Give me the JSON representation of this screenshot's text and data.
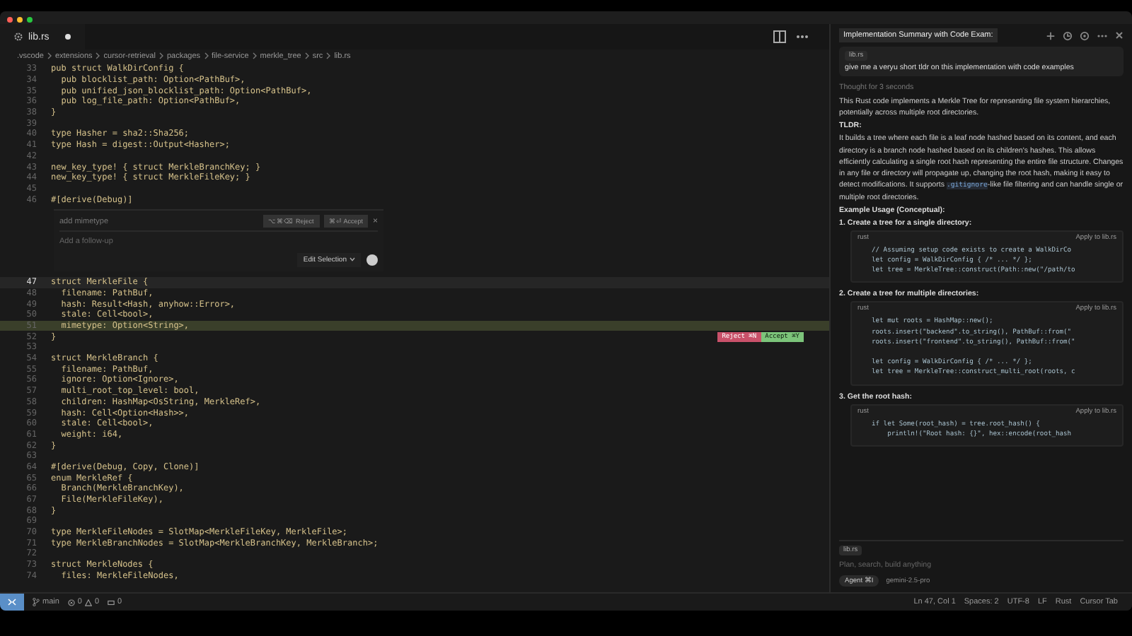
{
  "tab": {
    "label": "lib.rs",
    "modified": true
  },
  "breadcrumbs": [
    ".vscode",
    "extensions",
    "cursor-retrieval",
    "packages",
    "file-service",
    "merkle_tree",
    "src",
    "lib.rs"
  ],
  "code_before": [
    {
      "num": "33",
      "text": "pub struct WalkDirConfig {"
    },
    {
      "num": "34",
      "text": "  pub blocklist_path: Option<PathBuf>,"
    },
    {
      "num": "35",
      "text": "  pub unified_json_blocklist_path: Option<PathBuf>,"
    },
    {
      "num": "36",
      "text": "  pub log_file_path: Option<PathBuf>,"
    },
    {
      "num": "38",
      "text": "}"
    },
    {
      "num": "39"
    },
    {
      "num": "40",
      "text": "type Hasher = sha2::Sha256;"
    },
    {
      "num": "41",
      "text": "type Hash = digest::Output<Hasher>;"
    },
    {
      "num": "42"
    },
    {
      "num": "43",
      "text": "new_key_type! { struct MerkleBranchKey; }"
    },
    {
      "num": "44",
      "text": "new_key_type! { struct MerkleFileKey; }"
    },
    {
      "num": "45"
    },
    {
      "num": "46",
      "text": "#[derive(Debug)]"
    }
  ],
  "prompt": {
    "value": "add mimetype",
    "reject": "⌥⌘⌫ Reject",
    "accept": "⌘⏎ Accept",
    "close": "×",
    "followup_placeholder": "Add a follow-up",
    "mode": "Edit Selection"
  },
  "code_after": [
    {
      "num": "47",
      "text": "struct MerkleFile {",
      "current": true,
      "added": false
    },
    {
      "num": "48",
      "text": "  filename: PathBuf,",
      "current": false,
      "added": false
    },
    {
      "num": "49",
      "text": "  hash: Result<Hash, anyhow::Error>,",
      "current": false,
      "added": false
    },
    {
      "num": "50",
      "text": "  stale: Cell<bool>,",
      "current": false,
      "added": false
    },
    {
      "num": "51",
      "text": "  mimetype: Option<String>,",
      "current": false,
      "added": true
    },
    {
      "num": "52",
      "text": "}",
      "current": false,
      "added": false
    },
    {
      "num": "53",
      "current": false,
      "added": false
    },
    {
      "num": "54",
      "text": "struct MerkleBranch {",
      "current": false,
      "added": false
    },
    {
      "num": "55",
      "text": "  filename: PathBuf,",
      "current": false,
      "added": false
    },
    {
      "num": "56",
      "text": "  ignore: Option<Ignore>,",
      "current": false,
      "added": false
    },
    {
      "num": "57",
      "text": "  multi_root_top_level: bool,",
      "current": false,
      "added": false
    },
    {
      "num": "58",
      "text": "  children: HashMap<OsString, MerkleRef>,",
      "current": false,
      "added": false
    },
    {
      "num": "59",
      "text": "  hash: Cell<Option<Hash>>,",
      "current": false,
      "added": false
    },
    {
      "num": "60",
      "text": "  stale: Cell<bool>,",
      "current": false,
      "added": false
    },
    {
      "num": "61",
      "text": "  weight: i64,",
      "current": false,
      "added": false
    },
    {
      "num": "62",
      "text": "}",
      "current": false,
      "added": false
    },
    {
      "num": "63",
      "current": false,
      "added": false
    },
    {
      "num": "64",
      "text": "#[derive(Debug, Copy, Clone)]",
      "current": false,
      "added": false
    },
    {
      "num": "65",
      "text": "enum MerkleRef {",
      "current": false,
      "added": false
    },
    {
      "num": "66",
      "text": "  Branch(MerkleBranchKey),",
      "current": false,
      "added": false
    },
    {
      "num": "67",
      "text": "  File(MerkleFileKey),",
      "current": false,
      "added": false
    },
    {
      "num": "68",
      "text": "}",
      "current": false,
      "added": false
    },
    {
      "num": "69",
      "current": false,
      "added": false
    },
    {
      "num": "70",
      "text": "type MerkleFileNodes = SlotMap<MerkleFileKey, MerkleFile>;",
      "current": false,
      "added": false
    },
    {
      "num": "71",
      "text": "type MerkleBranchNodes = SlotMap<MerkleBranchKey, MerkleBranch>;",
      "current": false,
      "added": false
    },
    {
      "num": "72",
      "current": false,
      "added": false
    },
    {
      "num": "73",
      "text": "struct MerkleNodes {",
      "current": false,
      "added": false
    },
    {
      "num": "74",
      "text": "  files: MerkleFileNodes,",
      "current": false,
      "added": false
    }
  ],
  "diff_actions": {
    "reject": "Reject ⌘N",
    "accept": "Accept ⌘Y"
  },
  "chat": {
    "title": "Implementation Summary with Code Exam:",
    "context_chip": "lib.rs",
    "user_message": "give me a veryu short tldr on this implementation with code examples",
    "thought": "Thought for 3 seconds",
    "intro": "This Rust code implements a Merkle Tree for representing file system hierarchies, potentially across multiple root directories.",
    "tldr_heading": "TLDR:",
    "tldr_before": "It builds a tree where each file is a leaf node hashed based on its content, and each directory is a branch node hashed based on its children's hashes. This allows efficiently calculating a single root hash representing the entire file structure. Changes in any file or directory will propagate up, changing the root hash, making it easy to detect modifications. It supports",
    "tldr_code": ".gitignore",
    "tldr_after": "-like file filtering and can handle single or multiple root directories.",
    "example_heading": "Example Usage (Conceptual):",
    "steps": [
      {
        "title": "1. Create a tree for a single directory:",
        "lang": "rust",
        "apply": "Apply to lib.rs",
        "groups": [
          [
            "// Assuming setup code exists to create a WalkDirCo",
            "let config = WalkDirConfig { /* ... */ };",
            "let tree = MerkleTree::construct(Path::new(\"/path/to"
          ]
        ]
      },
      {
        "title": "2. Create a tree for multiple directories:",
        "lang": "rust",
        "apply": "Apply to lib.rs",
        "groups": [
          [
            "let mut roots = HashMap::new();",
            "roots.insert(\"backend\".to_string(), PathBuf::from(\"",
            "roots.insert(\"frontend\".to_string(), PathBuf::from(\""
          ],
          [
            "let config = WalkDirConfig { /* ... */ };",
            "let tree = MerkleTree::construct_multi_root(roots, c"
          ]
        ]
      },
      {
        "title": "3. Get the root hash:",
        "lang": "rust",
        "apply": "Apply to lib.rs",
        "groups": [
          [
            "if let Some(root_hash) = tree.root_hash() {",
            "    println!(\"Root hash: {}\", hex::encode(root_hash"
          ]
        ]
      }
    ],
    "input_chip": "lib.rs",
    "input_placeholder": "Plan, search, build anything",
    "agent": "Agent ⌘I",
    "model": "gemini-2.5-pro"
  },
  "status_left": {
    "branch": "main",
    "errors": "0",
    "warnings": "0",
    "ports": "0"
  },
  "status_right": [
    "Ln 47, Col 1",
    "Spaces: 2",
    "UTF-8",
    "LF",
    "Rust",
    "Cursor Tab"
  ]
}
